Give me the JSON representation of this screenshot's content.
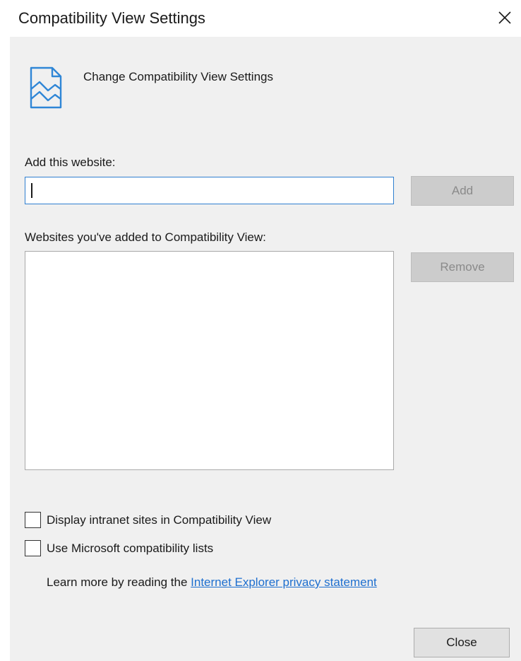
{
  "window": {
    "title": "Compatibility View Settings"
  },
  "header": {
    "icon": "compatibility-view-icon",
    "text": "Change Compatibility View Settings"
  },
  "add_section": {
    "label": "Add this website:",
    "input_value": "",
    "add_button": "Add"
  },
  "list_section": {
    "label": "Websites you've added to Compatibility View:",
    "items": [],
    "remove_button": "Remove"
  },
  "options": {
    "intranet": {
      "label": "Display intranet sites in Compatibility View",
      "checked": false
    },
    "ms_lists": {
      "label": "Use Microsoft compatibility lists",
      "checked": false
    }
  },
  "learn_more": {
    "prefix": "Learn more by reading the",
    "link_text": "Internet Explorer privacy statement"
  },
  "footer": {
    "close_button": "Close"
  },
  "colors": {
    "accent": "#2f7fd0",
    "link": "#1e6fcf",
    "panel": "#f0f0f0",
    "disabled_button": "#cccccc"
  }
}
